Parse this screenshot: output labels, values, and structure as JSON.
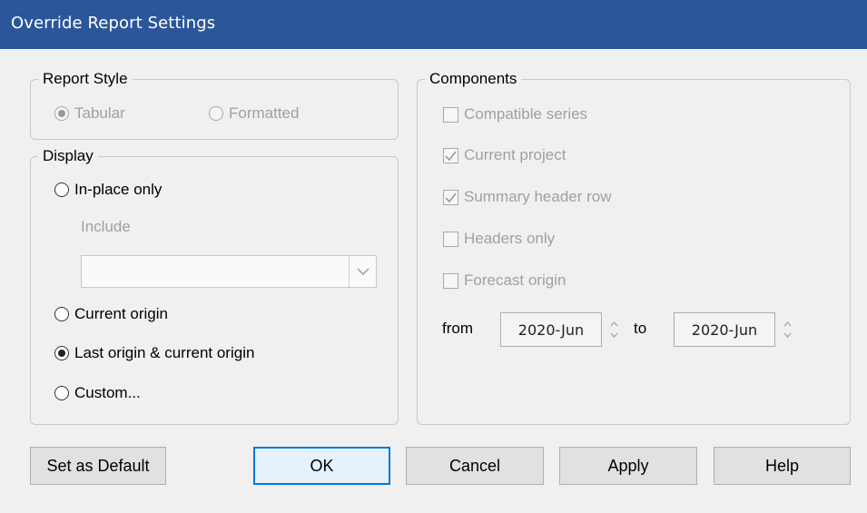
{
  "window": {
    "title": "Override Report Settings"
  },
  "report_style": {
    "legend": "Report Style",
    "options": [
      {
        "label": "Tabular",
        "selected": true,
        "enabled": false
      },
      {
        "label": "Formatted",
        "selected": false,
        "enabled": false
      }
    ]
  },
  "display": {
    "legend": "Display",
    "in_place_only": "In-place only",
    "include_label": "Include",
    "include_value": "",
    "current_origin": "Current origin",
    "last_and_current": "Last origin & current origin",
    "custom": "Custom...",
    "selected": "Last origin & current origin"
  },
  "components": {
    "legend": "Components",
    "items": [
      {
        "label": "Compatible series",
        "checked": false,
        "enabled": false
      },
      {
        "label": "Current project",
        "checked": true,
        "enabled": false
      },
      {
        "label": "Summary header row",
        "checked": true,
        "enabled": false
      },
      {
        "label": "Headers only",
        "checked": false,
        "enabled": false
      },
      {
        "label": "Forecast origin",
        "checked": false,
        "enabled": false
      }
    ],
    "from_label": "from",
    "from_value": "2020-Jun",
    "to_label": "to",
    "to_value": "2020-Jun"
  },
  "buttons": {
    "set_default": "Set as Default",
    "ok": "OK",
    "cancel": "Cancel",
    "apply": "Apply",
    "help": "Help"
  },
  "colors": {
    "titlebar": "#2b579a",
    "default_button_border": "#0078d7"
  }
}
